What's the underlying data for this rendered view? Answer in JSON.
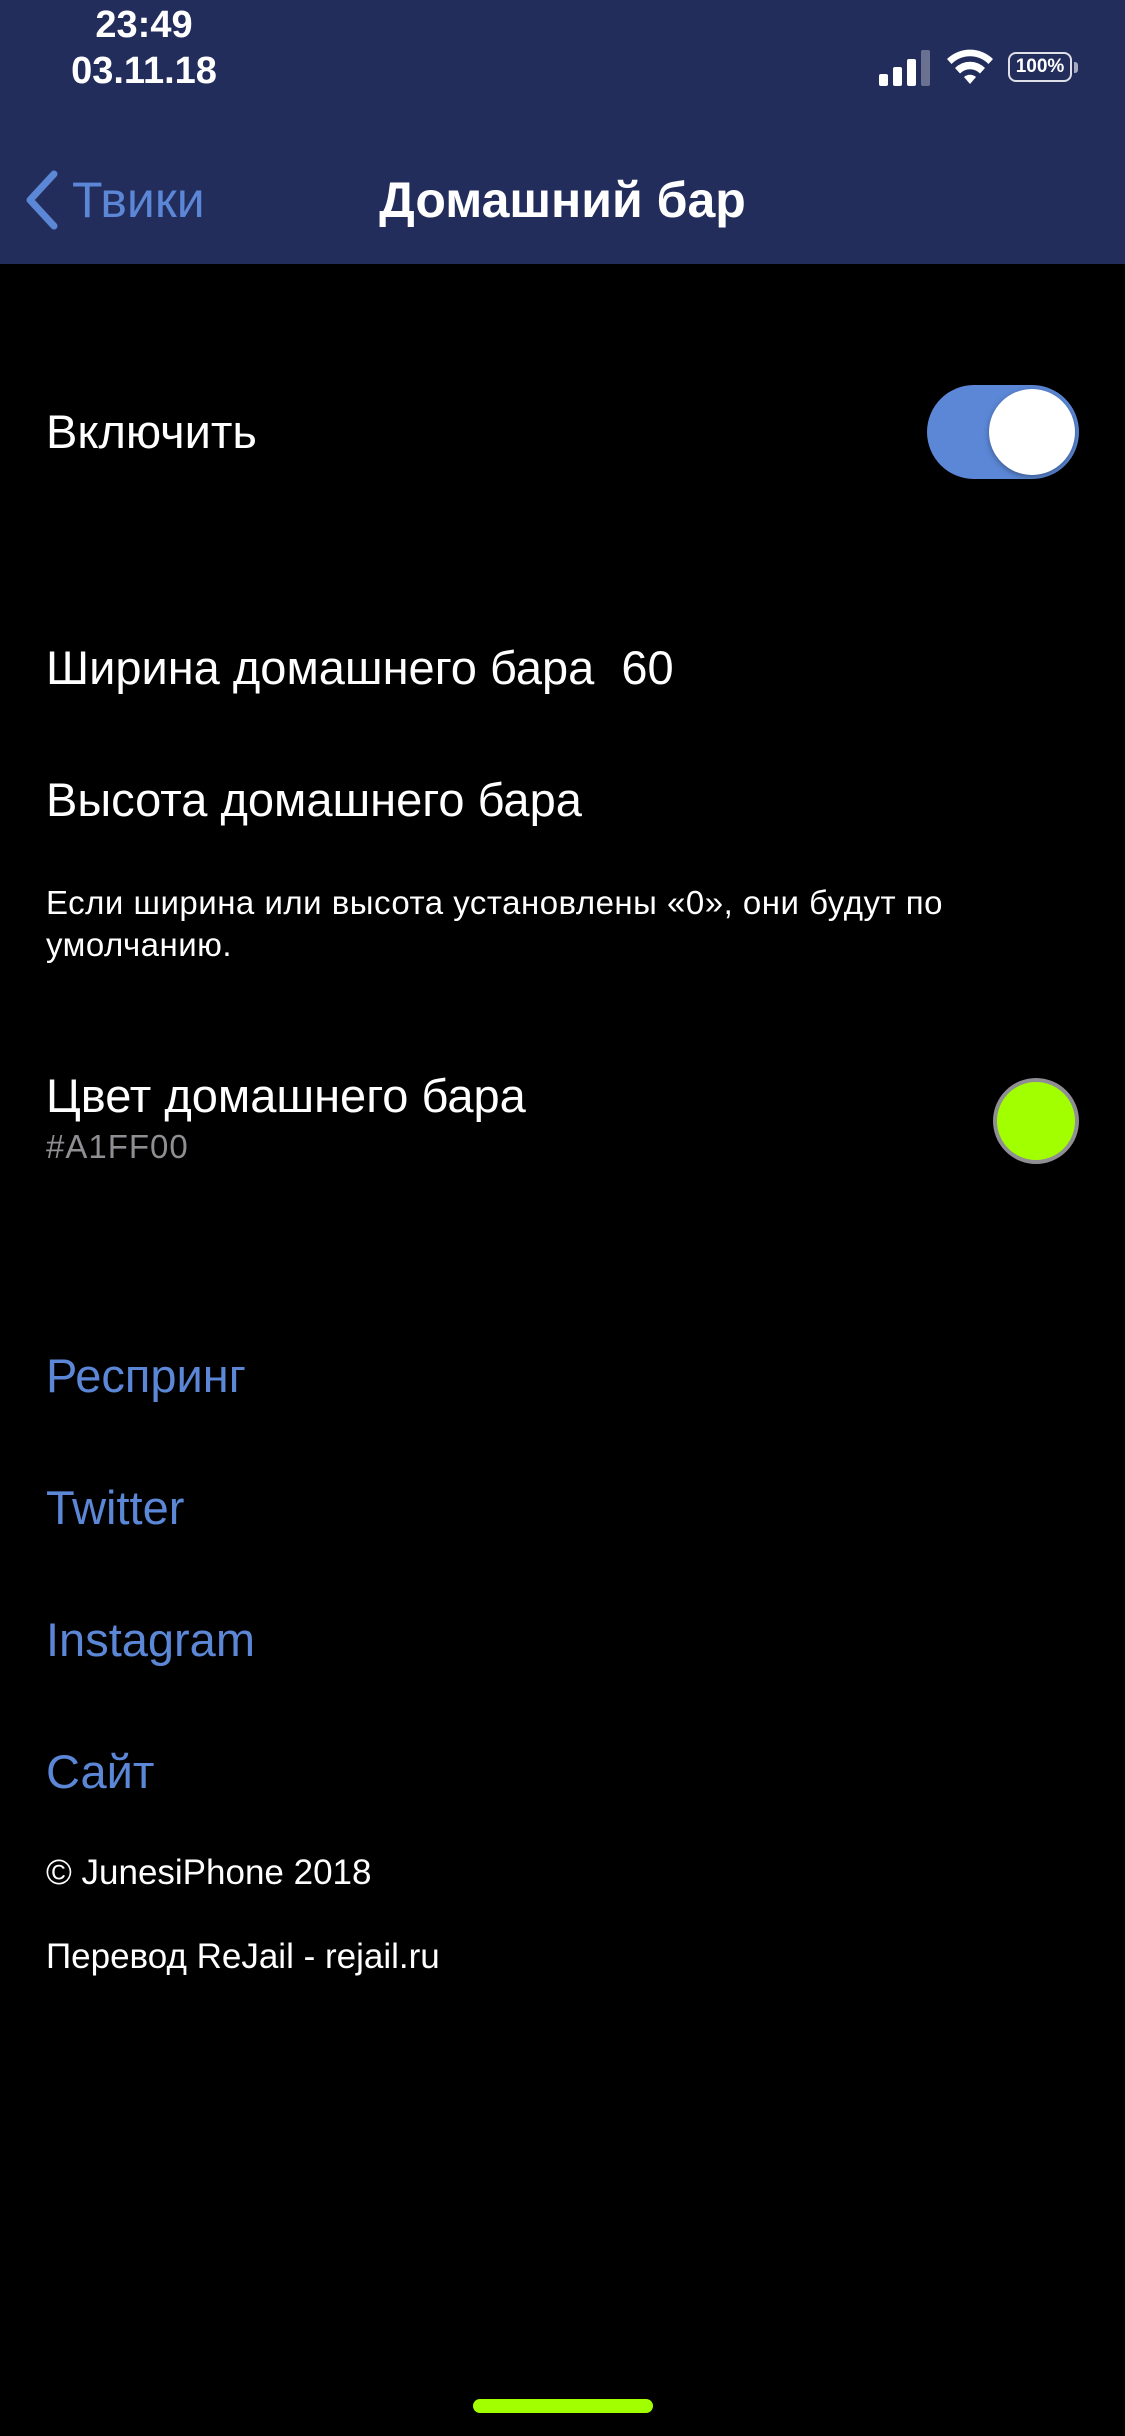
{
  "status_bar": {
    "time": "23:49",
    "date": "03.11.18",
    "battery": "100%"
  },
  "nav": {
    "back_label": "Твики",
    "title": "Домашний бар"
  },
  "settings": {
    "enable_label": "Включить",
    "enable_on": true,
    "width_label": "Ширина домашнего бара",
    "width_value": "60",
    "height_label": "Высота домашнего бара",
    "footnote": "Если ширина или высота установлены «0», они будут по умолчанию.",
    "color_label": "Цвет домашнего бара",
    "color_hex": "#A1FF00"
  },
  "links": {
    "respring": "Респринг",
    "twitter": "Twitter",
    "instagram": "Instagram",
    "site": "Сайт"
  },
  "footer": {
    "copyright": "© JunesiPhone 2018",
    "translation": "Перевод ReJail - rejail.ru"
  },
  "colors": {
    "header_bg": "#232d5c",
    "accent": "#5b87d6",
    "bar_color": "#A1FF00",
    "background": "#000000"
  },
  "icons": {
    "back": "chevron-left-icon",
    "signal": "cellular-signal-icon",
    "wifi": "wifi-icon",
    "battery": "battery-icon"
  }
}
